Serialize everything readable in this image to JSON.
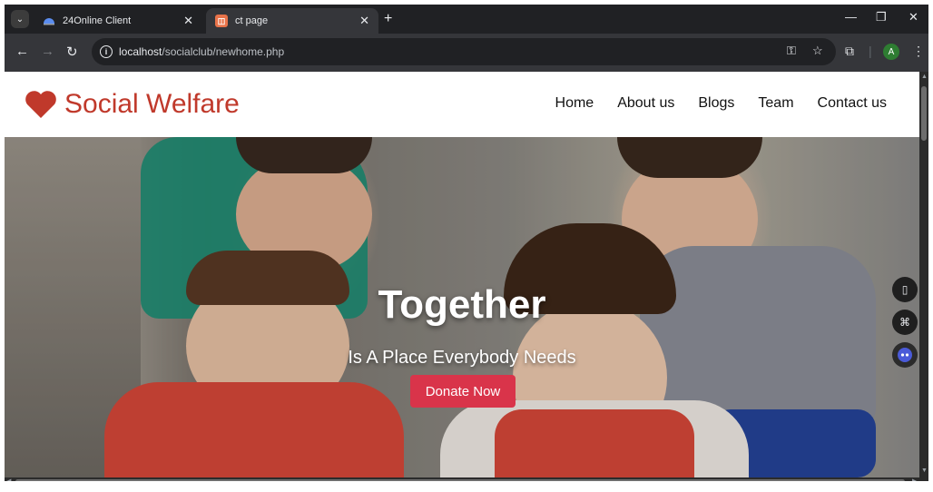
{
  "browser": {
    "tabs": [
      {
        "title": "24Online Client",
        "active": false
      },
      {
        "title": "ct page",
        "active": true
      }
    ],
    "url_host": "localhost",
    "url_path": "/socialclub/newhome.php",
    "profile_initial": "A",
    "icons": {
      "tab_search": "chevron-down-icon",
      "back": "back-arrow-icon",
      "forward": "forward-arrow-icon",
      "reload": "reload-icon",
      "info": "site-info-icon",
      "password": "key-icon",
      "bookmark": "star-icon",
      "extensions": "puzzle-icon",
      "menu": "kebab-menu-icon"
    }
  },
  "site": {
    "brand": "Social Welfare",
    "brand_color": "#c0392b",
    "nav": [
      "Home",
      "About us",
      "Blogs",
      "Team",
      "Contact us"
    ]
  },
  "hero": {
    "title": "Together",
    "subtitle": "Is A Place Everybody Needs",
    "cta": "Donate Now",
    "cta_color": "#d9344a"
  }
}
